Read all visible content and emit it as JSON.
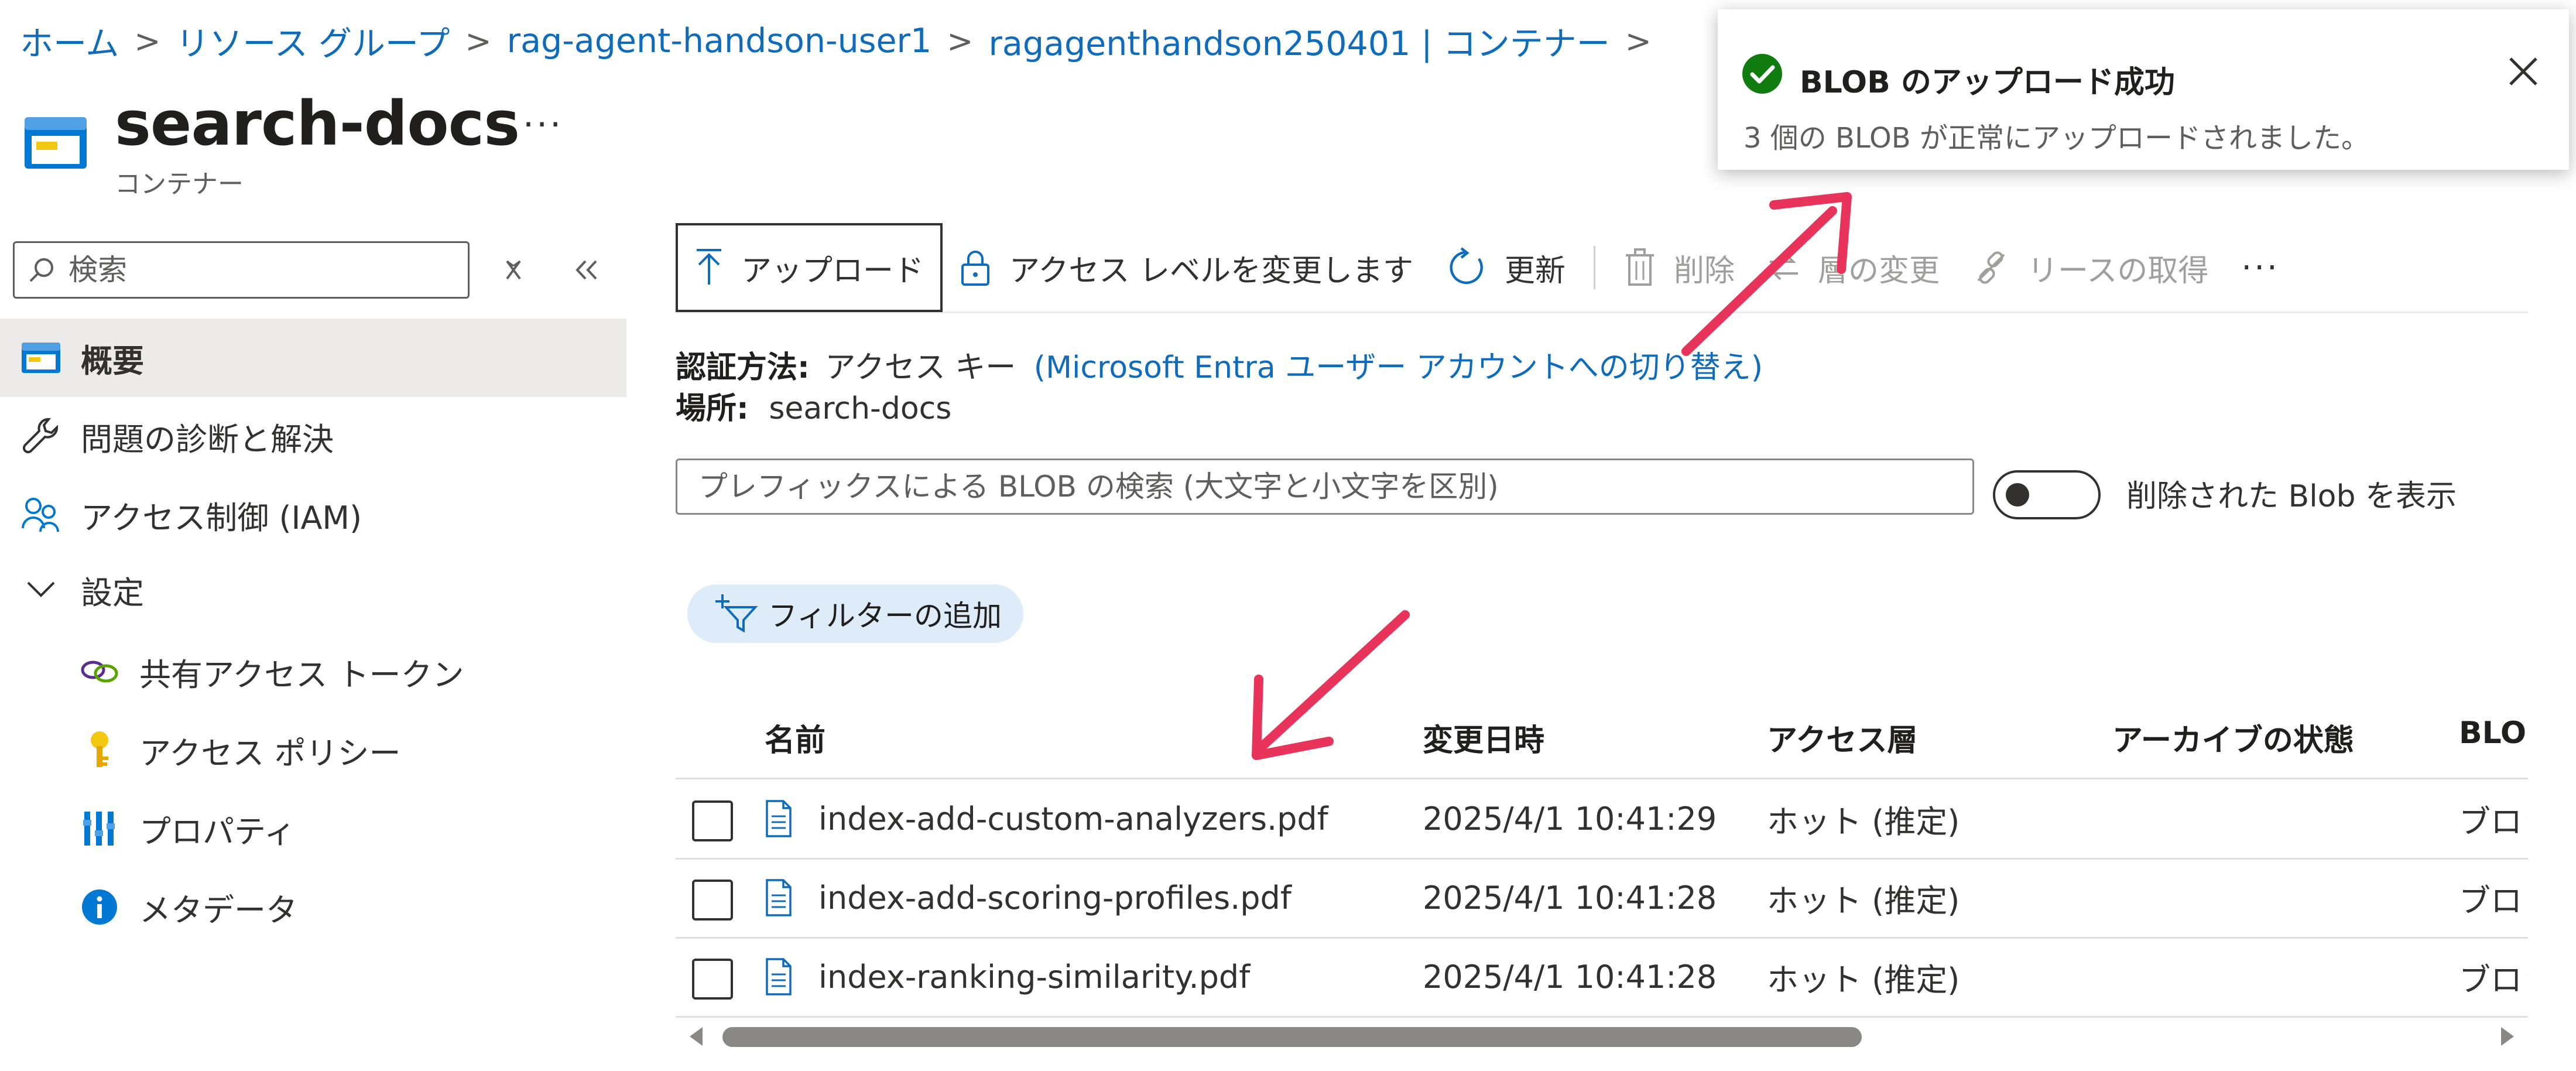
{
  "breadcrumb": {
    "items": [
      "ホーム",
      "リソース グループ",
      "rag-agent-handson-user1",
      "ragagenthandson250401 | コンテナー"
    ]
  },
  "header": {
    "title": "search-docs",
    "subtitle": "コンテナー",
    "more": "···"
  },
  "sidebar": {
    "search_placeholder": "検索",
    "items": [
      {
        "label": "概要",
        "icon": "container-icon",
        "selected": true
      },
      {
        "label": "問題の診断と解決",
        "icon": "wrench-icon"
      },
      {
        "label": "アクセス制御 (IAM)",
        "icon": "people-icon"
      },
      {
        "label": "設定",
        "icon": "chevron-down-icon"
      },
      {
        "label": "共有アクセス トークン",
        "icon": "link-icon"
      },
      {
        "label": "アクセス ポリシー",
        "icon": "key-icon"
      },
      {
        "label": "プロパティ",
        "icon": "properties-icon"
      },
      {
        "label": "メタデータ",
        "icon": "info-icon"
      }
    ]
  },
  "toolbar": {
    "upload": "アップロード",
    "access_level": "アクセス レベルを変更します",
    "refresh": "更新",
    "delete": "削除",
    "change_tier": "層の変更",
    "acquire_lease": "リースの取得",
    "more": "···"
  },
  "auth": {
    "method_label": "認証方法:",
    "method_value": "アクセス キー",
    "switch_link": "(Microsoft Entra ユーザー アカウントへの切り替え)",
    "location_label": "場所:",
    "location_value": "search-docs"
  },
  "blob_search": {
    "placeholder": "プレフィックスによる BLOB の検索 (大文字と小文字を区別)"
  },
  "show_deleted": {
    "label": "削除された Blob を表示",
    "on": false
  },
  "filter": {
    "label": "フィルターの追加"
  },
  "table": {
    "columns": [
      "名前",
      "変更日時",
      "アクセス層",
      "アーカイブの状態",
      "BLOB"
    ],
    "rows": [
      {
        "name": "index-add-custom-analyzers.pdf",
        "modified": "2025/4/1 10:41:29",
        "tier": "ホット (推定)",
        "archive": "",
        "blob_type": "ブロック"
      },
      {
        "name": "index-add-scoring-profiles.pdf",
        "modified": "2025/4/1 10:41:28",
        "tier": "ホット (推定)",
        "archive": "",
        "blob_type": "ブロック"
      },
      {
        "name": "index-ranking-similarity.pdf",
        "modified": "2025/4/1 10:41:28",
        "tier": "ホット (推定)",
        "archive": "",
        "blob_type": "ブロック"
      }
    ]
  },
  "toast": {
    "title": "BLOB のアップロード成功",
    "message": "3 個の BLOB が正常にアップロードされました。"
  },
  "colors": {
    "accent": "#0f6cbd",
    "success": "#107c10",
    "annotation_arrow": "#e8345a",
    "selected_bg": "#edebe9"
  }
}
